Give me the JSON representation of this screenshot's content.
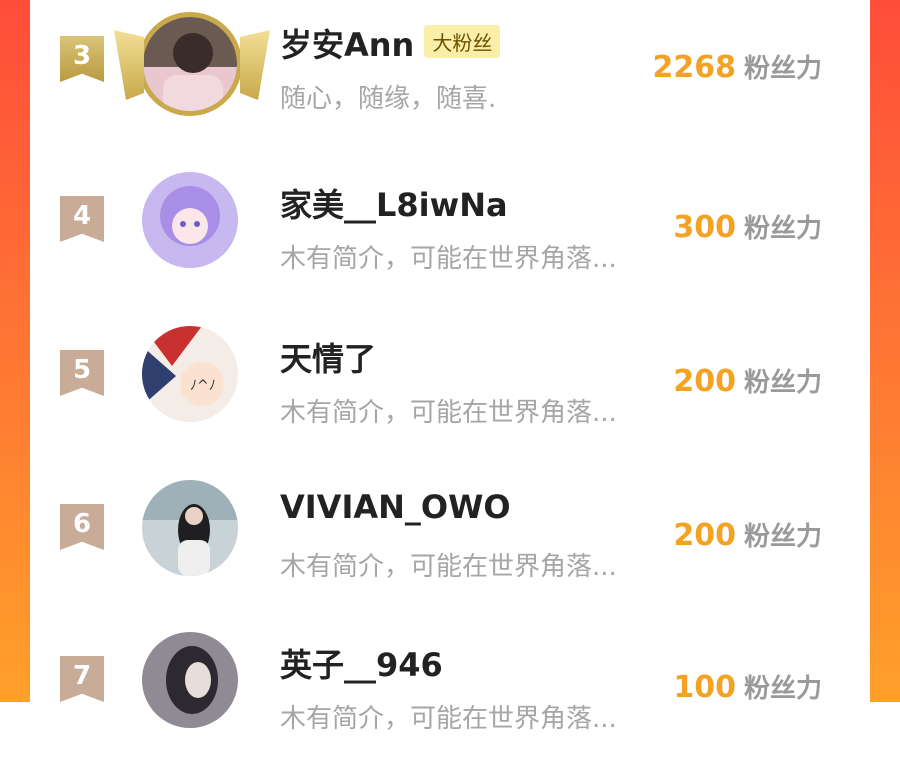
{
  "rows": [
    {
      "rank": "3",
      "name": "岁安Ann",
      "tag": "大粉丝",
      "bio": "随心，随缘，随喜.",
      "score": "2268",
      "unit": "粉丝力"
    },
    {
      "rank": "4",
      "name": "家美__L8iwNa",
      "bio": "木有简介，可能在世界角落...",
      "score": "300",
      "unit": "粉丝力"
    },
    {
      "rank": "5",
      "name": "天情了",
      "bio": "木有简介，可能在世界角落...",
      "score": "200",
      "unit": "粉丝力"
    },
    {
      "rank": "6",
      "name": "VIVIAN_OWO",
      "bio": "木有简介，可能在世界角落...",
      "score": "200",
      "unit": "粉丝力"
    },
    {
      "rank": "7",
      "name": "英子__946",
      "bio": "木有简介，可能在世界角落...",
      "score": "100",
      "unit": "粉丝力"
    }
  ],
  "colors": {
    "accent": "#f3a223",
    "badge_bg": "#fbeea8",
    "rank_badge": "#c9ac98",
    "gold": "#c9a94a"
  }
}
